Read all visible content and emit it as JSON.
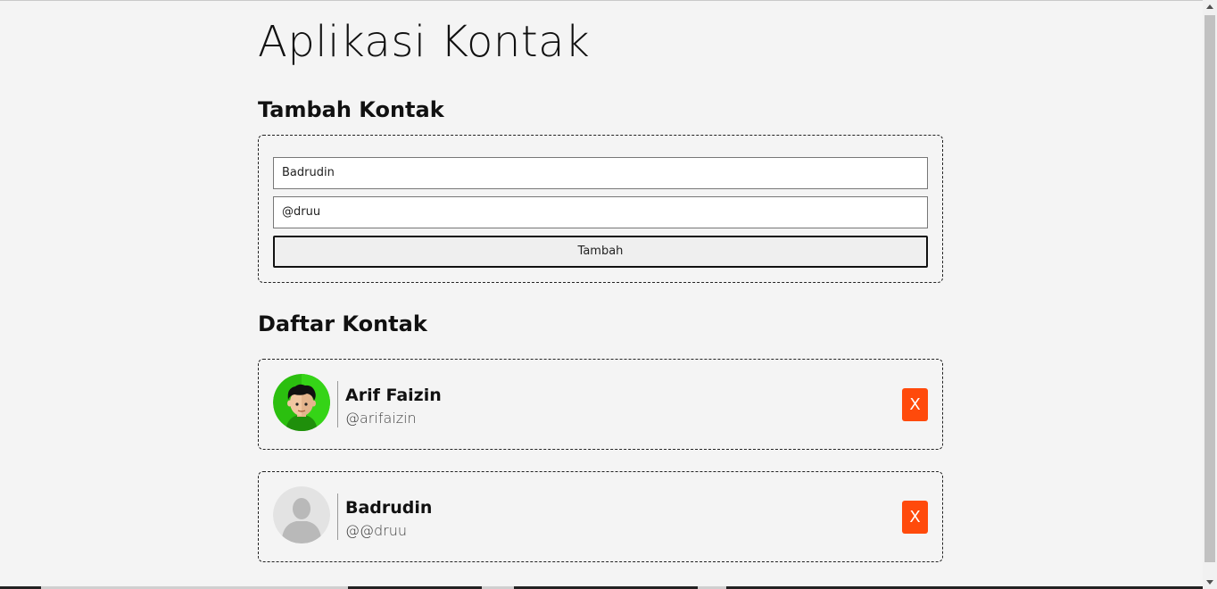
{
  "app": {
    "title": "Aplikasi Kontak"
  },
  "add_section": {
    "title": "Tambah Kontak",
    "name_value": "Badrudin",
    "username_value": "@druu",
    "submit_label": "Tambah"
  },
  "list_section": {
    "title": "Daftar Kontak",
    "contacts": [
      {
        "name": "Arif Faizin",
        "username": "@arifaizin",
        "avatar": "cartoon-boy-avatar",
        "delete_label": "X"
      },
      {
        "name": "Badrudin",
        "username": "@@druu",
        "avatar": "default-person-avatar",
        "delete_label": "X"
      }
    ]
  },
  "colors": {
    "background": "#f4f4f4",
    "delete_button": "#ff4a0b",
    "avatar_green": "#2bbf0f"
  }
}
